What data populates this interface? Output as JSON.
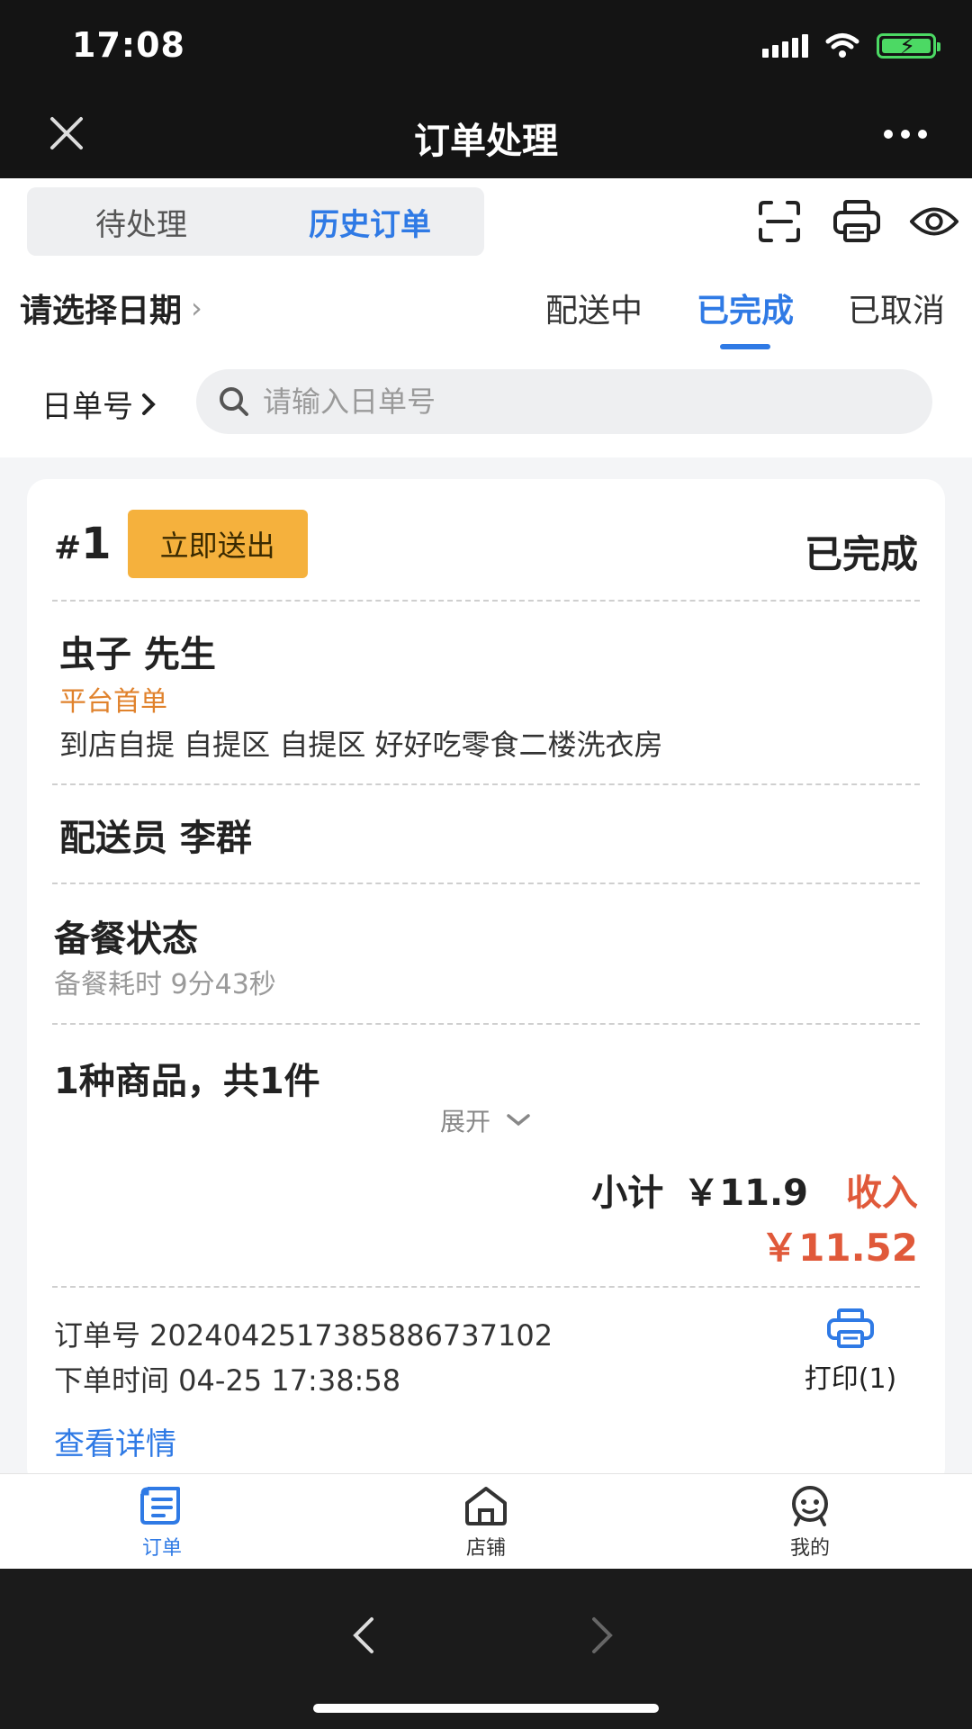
{
  "status_bar": {
    "time": "17:08"
  },
  "nav": {
    "title": "订单处理"
  },
  "segment": {
    "tabs": [
      "待处理",
      "历史订单"
    ],
    "active_index": 1
  },
  "date_picker": {
    "label": "请选择日期"
  },
  "status_tabs": {
    "items": [
      "配送中",
      "已完成",
      "已取消"
    ],
    "active_index": 1
  },
  "search": {
    "label": "日单号",
    "placeholder": "请输入日单号"
  },
  "order": {
    "index_symbol": "#",
    "index_number": "1",
    "send_label": "立即送出",
    "status": "已完成",
    "customer_name": "虫子 先生",
    "customer_tag": "平台首单",
    "address": "到店自提 自提区 自提区 好好吃零食二楼洗衣房",
    "rider": "配送员 李群",
    "prep_title": "备餐状态",
    "prep_time": "备餐耗时 9分43秒",
    "goods_summary": "1种商品，共1件",
    "expand_label": "展开",
    "subtotal_label": "小计",
    "subtotal_amount": "￥11.9",
    "income_label": "收入",
    "income_amount": "￥11.52",
    "order_number": "订单号 20240425173858867371​02",
    "order_time": "下单时间 04-25 17:38:58",
    "print_label": "打印(1)",
    "detail_link": "查看详情"
  },
  "tabbar": {
    "items": [
      "订单",
      "店铺",
      "我的"
    ],
    "active_index": 0
  },
  "colors": {
    "accent": "#2f7ae5",
    "warning": "#f5b13d",
    "income": "#e0593a",
    "tag": "#e0822c"
  },
  "icons": [
    "close-icon",
    "more-icon",
    "scan-icon",
    "printer-icon",
    "eye-icon",
    "search-icon",
    "chevron-down-icon",
    "order-icon",
    "store-icon",
    "profile-icon",
    "back-arrow-icon",
    "forward-arrow-icon"
  ]
}
